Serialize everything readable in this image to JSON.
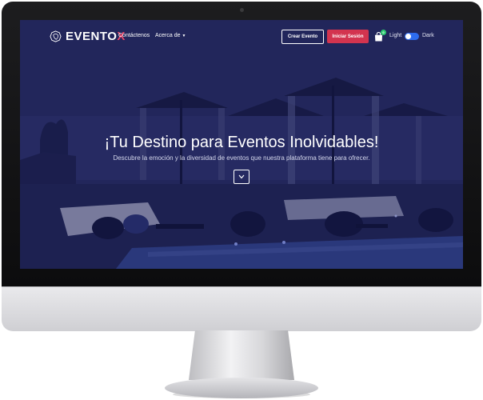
{
  "brand": {
    "name_main": "EVENTO",
    "name_accent": "X",
    "accent_color": "#e8476a",
    "icon": "lion-logo-icon"
  },
  "nav": {
    "links": [
      {
        "label": "Contáctenos"
      },
      {
        "label": "Acerca de",
        "icon": "caret-down-icon"
      }
    ],
    "create_event_label": "Crear Evento",
    "login_label": "Iniciar Sesión",
    "login_color": "#d3344f",
    "cart": {
      "icon": "shopping-bag-icon",
      "count": "0",
      "badge_color": "#2ecc71"
    },
    "theme": {
      "light_label": "Light",
      "dark_label": "Dark",
      "toggle_color": "#2d6cf0"
    }
  },
  "hero": {
    "title": "¡Tu Destino para Eventos Inolvidables!",
    "subtitle": "Descubre la emoción y la diversidad de eventos que nuestra plataforma tiene para ofrecer.",
    "scroll_icon": "chevron-down-icon"
  }
}
